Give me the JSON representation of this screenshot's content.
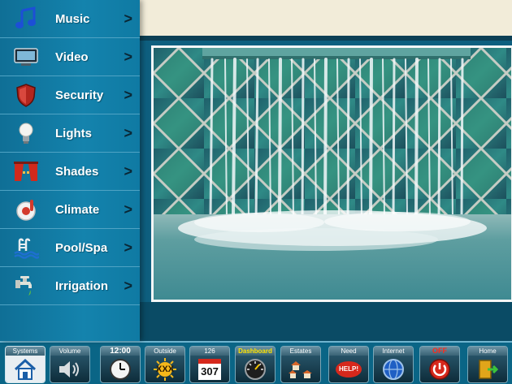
{
  "menu": {
    "items": [
      {
        "label": "Music",
        "icon": "music-note-icon",
        "chevron": ">"
      },
      {
        "label": "Video",
        "icon": "tv-icon",
        "chevron": ">"
      },
      {
        "label": "Security",
        "icon": "shield-icon",
        "chevron": ">"
      },
      {
        "label": "Lights",
        "icon": "lightbulb-icon",
        "chevron": ">"
      },
      {
        "label": "Shades",
        "icon": "curtains-icon",
        "chevron": ">"
      },
      {
        "label": "Climate",
        "icon": "thermostat-icon",
        "chevron": ">"
      },
      {
        "label": "Pool/Spa",
        "icon": "pool-ladder-icon",
        "chevron": ">"
      },
      {
        "label": "Irrigation",
        "icon": "faucet-icon",
        "chevron": ">"
      }
    ]
  },
  "toolbar": {
    "systems": {
      "label": "Systems",
      "icon": "house-icon"
    },
    "volume": {
      "label": "Volume",
      "icon": "speaker-icon"
    },
    "clock": {
      "label": "12:00",
      "icon": "clock-icon"
    },
    "outside": {
      "label": "Outside",
      "value": "XXX",
      "icon": "sun-icon"
    },
    "calendar": {
      "label": "126",
      "value": "307",
      "icon": "calendar-icon"
    },
    "dashboard": {
      "label": "Dashboard",
      "icon": "gauge-icon"
    },
    "estates": {
      "label": "Estates",
      "icon": "houses-icon"
    },
    "need": {
      "label": "Need",
      "value": "HELP!",
      "icon": "help-bubble-icon"
    },
    "internet": {
      "label": "Internet",
      "icon": "globe-icon"
    },
    "off": {
      "label": "OFF",
      "icon": "power-icon"
    },
    "home": {
      "label": "Home",
      "icon": "exit-door-icon"
    }
  },
  "colors": {
    "sidebar": "#1483ad",
    "top_band": "#f2ecd9",
    "off_red": "#ff2a1a",
    "dashboard_yellow": "#ffe300"
  }
}
